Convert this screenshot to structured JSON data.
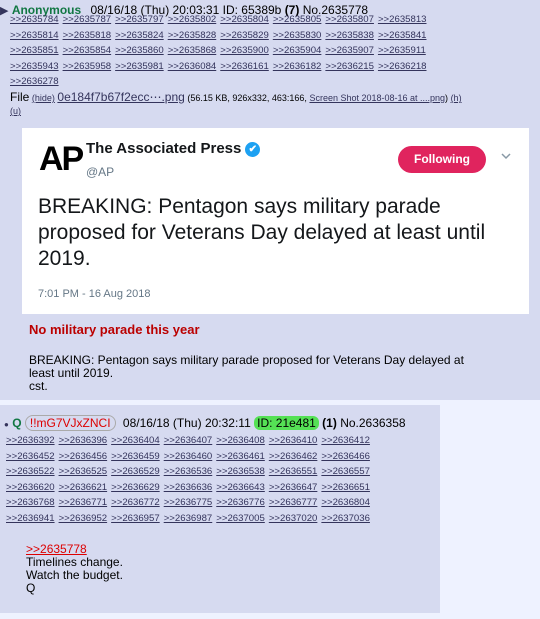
{
  "post1": {
    "arrow": "▶",
    "name": "Anonymous",
    "datetime": "08/16/18 (Thu) 20:03:31",
    "id_label": "ID:",
    "id_value": "65389b",
    "id_count": "(7)",
    "post_no": "No.2635778",
    "backlinks": [
      ">>2635784",
      ">>2635787",
      ">>2635797",
      ">>2635802",
      ">>2635804",
      ">>2635805",
      ">>2635807",
      ">>2635813",
      ">>2635814",
      ">>2635818",
      ">>2635824",
      ">>2635828",
      ">>2635829",
      ">>2635830",
      ">>2635838",
      ">>2635841",
      ">>2635851",
      ">>2635854",
      ">>2635860",
      ">>2635868",
      ">>2635900",
      ">>2635904",
      ">>2635907",
      ">>2635911",
      ">>2635943",
      ">>2635958",
      ">>2635981",
      ">>2636084",
      ">>2636161",
      ">>2636182",
      ">>2636215",
      ">>2636218",
      ">>2636278"
    ],
    "file_label": "File",
    "file_hide": "(hide)",
    "file_name": "0e184f7b67f2ecc⋯.png",
    "file_meta": "(56.15 KB, 926x332, 463:166,",
    "file_orig": "Screen Shot 2018-08-16 at ....png",
    "file_close": ")",
    "file_h": "(h)",
    "file_u": "(u)",
    "tweet": {
      "logo": "AP",
      "account": "The Associated Press",
      "handle": "@AP",
      "follow_label": "Following",
      "text": "BREAKING: Pentagon says military parade proposed for Veterans Day delayed at least until 2019.",
      "date": "7:01 PM - 16 Aug 2018"
    },
    "subject": "No military parade this year",
    "body_line1": "BREAKING: Pentagon says military parade proposed for Veterans Day delayed at",
    "body_line2": "least until 2019.",
    "body_line3": "cst."
  },
  "post2": {
    "name": "Q",
    "trip": "!!mG7VJxZNCI",
    "datetime": "08/16/18 (Thu) 20:32:11",
    "id_value": "ID: 21e481",
    "id_count": "(1)",
    "post_no": "No.2636358",
    "backlinks": [
      ">>2636392",
      ">>2636396",
      ">>2636404",
      ">>2636407",
      ">>2636408",
      ">>2636410",
      ">>2636412",
      ">>2636452",
      ">>2636456",
      ">>2636459",
      ">>2636460",
      ">>2636461",
      ">>2636462",
      ">>2636466",
      ">>2636522",
      ">>2636525",
      ">>2636529",
      ">>2636536",
      ">>2636538",
      ">>2636551",
      ">>2636557",
      ">>2636620",
      ">>2636621",
      ">>2636629",
      ">>2636636",
      ">>2636643",
      ">>2636647",
      ">>2636651",
      ">>2636768",
      ">>2636771",
      ">>2636772",
      ">>2636775",
      ">>2636776",
      ">>2636777",
      ">>2636804",
      ">>2636941",
      ">>2636952",
      ">>2636957",
      ">>2636987",
      ">>2637005",
      ">>2637020",
      ">>2637036"
    ],
    "quote_link": ">>2635778",
    "line1": "Timelines change.",
    "line2": "Watch the budget.",
    "line3": "Q"
  }
}
